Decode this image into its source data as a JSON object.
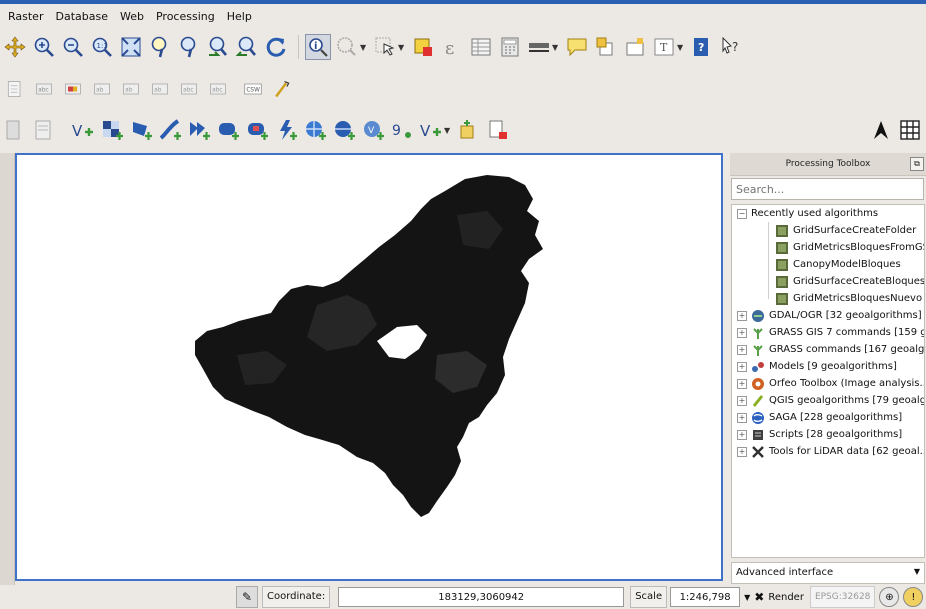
{
  "menu": [
    "Raster",
    "Database",
    "Web",
    "Processing",
    "Help"
  ],
  "toolbar_icons": {
    "row1": [
      "pan-icon",
      "zoom-in-icon",
      "zoom-out-icon",
      "zoom-native-icon",
      "zoom-full-icon",
      "zoom-selection-icon",
      "zoom-layer-icon",
      "zoom-last-icon",
      "zoom-next-icon",
      "refresh-icon",
      "identify-icon",
      "select-icon",
      "select-tool-icon",
      "deselect-icon",
      "measure-icon",
      "attribute-table-icon",
      "field-calculator-icon",
      "measure-line-icon",
      "map-tips-icon",
      "bookmarks-icon",
      "annotation-icon",
      "text-annotation-icon",
      "help-icon",
      "whats-this-icon"
    ],
    "row2": [
      "label-toolbar-icon",
      "layer-labeling-icon",
      "pin-labels-icon",
      "show-labels-icon",
      "move-label-icon",
      "rotate-label-icon",
      "change-label-icon",
      "csw-icon",
      "gps-icon"
    ],
    "row3": [
      "add-vector-layer-icon",
      "add-raster-layer-icon",
      "add-postgis-layer-icon",
      "add-spatialite-layer-icon",
      "add-mssql-layer-icon",
      "add-oracle-layer-icon",
      "add-wms-layer-icon",
      "add-wcs-layer-icon",
      "add-wfs-layer-icon",
      "add-delimited-text-icon",
      "add-virtual-layer-icon",
      "new-shapefile-icon",
      "new-spatialite-icon",
      "new-temporary-layer-icon",
      "north-arrow-icon",
      "grid-icon"
    ]
  },
  "panel": {
    "title": "Processing Toolbox",
    "search_placeholder": "Search...",
    "recent_label": "Recently used algorithms",
    "recent": [
      "GridSurfaceCreateFolder",
      "GridMetricsBloquesFromGS...",
      "CanopyModelBloques",
      "GridSurfaceCreateBloques...",
      "GridMetricsBloquesNuevo"
    ],
    "providers": [
      {
        "label": "GDAL/OGR [32 geoalgorithms]",
        "icon": "gdal-icon",
        "color": "#3a7a3a"
      },
      {
        "label": "GRASS GIS 7 commands [159 g...",
        "icon": "grass-icon",
        "color": "#5aa04a"
      },
      {
        "label": "GRASS commands [167 geoalgo...",
        "icon": "grass-icon",
        "color": "#5aa04a"
      },
      {
        "label": "Models [9 geoalgorithms]",
        "icon": "models-icon",
        "color": "#b04040"
      },
      {
        "label": "Orfeo Toolbox (Image analysis...",
        "icon": "orfeo-icon",
        "color": "#d06020"
      },
      {
        "label": "QGIS geoalgorithms [79 geoalg...",
        "icon": "qgis-icon",
        "color": "#88b020"
      },
      {
        "label": "SAGA [228 geoalgorithms]",
        "icon": "saga-icon",
        "color": "#2a60c0"
      },
      {
        "label": "Scripts [28 geoalgorithms]",
        "icon": "scripts-icon",
        "color": "#404040"
      },
      {
        "label": "Tools for LiDAR data [62 geoal...",
        "icon": "lidar-icon",
        "color": "#303030"
      }
    ],
    "advanced": "Advanced interface",
    "float_glyph": "⧉"
  },
  "status": {
    "coordinate_label": "Coordinate:",
    "coordinate_value": "183129,3060942",
    "scale_label": "Scale",
    "scale_value": "1:246,798",
    "render_label": "Render",
    "epsg": "EPSG:32628",
    "render_checked": true
  },
  "colors": {
    "canvas_border": "#3f72c8",
    "raster_fill": "#121212",
    "raster_tone2": "#2a2a2a"
  }
}
